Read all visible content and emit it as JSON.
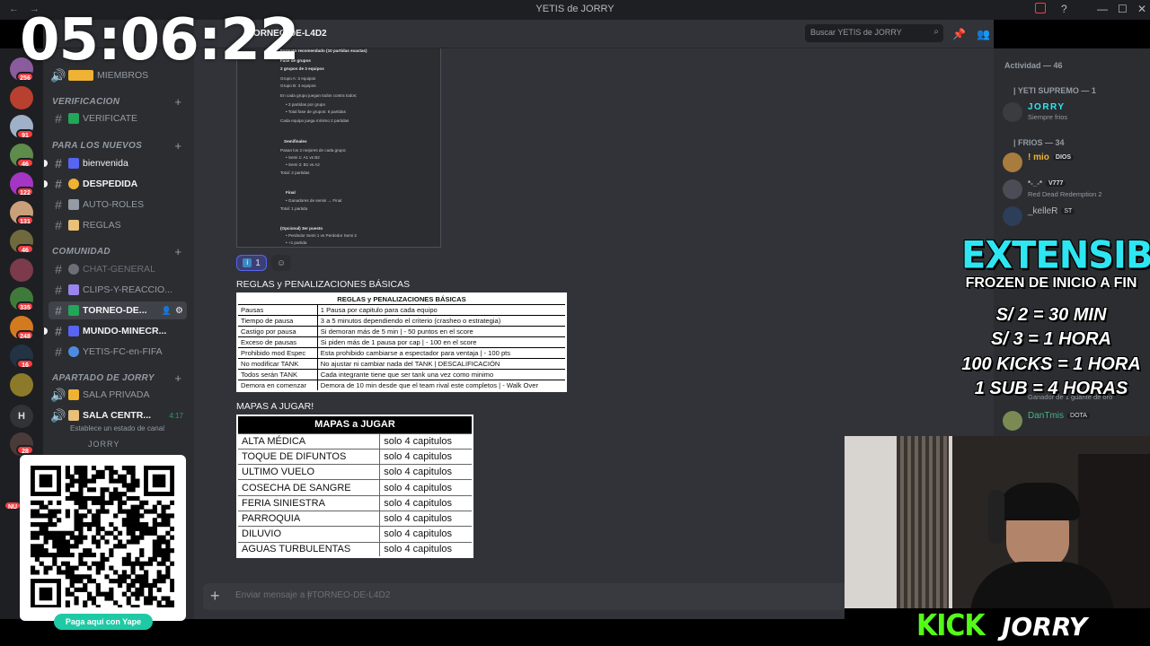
{
  "titlebar": {
    "title": "YETIS de JORRY"
  },
  "overlay": {
    "clock": "05:06:22",
    "extensible": "EXTENSIBLE",
    "frozen": "FROZEN DE INICIO A FIN",
    "prices": [
      "S/ 2 = 30 MIN",
      "S/ 3 = 1 HORA",
      "100 KICKS = 1 HORA",
      "1 SUB = 4 HORAS"
    ],
    "yape_button": "Paga aquí con Yape",
    "kick_logo": "KICK",
    "kick_name": "JORRY"
  },
  "guilds": {
    "badges": [
      "256",
      "91",
      "46",
      "122",
      "131",
      "46",
      "335",
      "248",
      "16",
      "28"
    ],
    "h_label": "H",
    "nu_label": "NU"
  },
  "server": {
    "name": "YETIS de JORRY"
  },
  "sidebar": {
    "top_channel": "MIEMBROS",
    "categories": [
      {
        "name": "VERIFICACION",
        "channels": [
          "VERIFICATE"
        ]
      },
      {
        "name": "PARA LOS NUEVOS",
        "channels": [
          "bienvenida",
          "DESPEDIDA",
          "AUTO-ROLES",
          "REGLAS"
        ]
      },
      {
        "name": "COMUNIDAD",
        "channels": [
          "CHAT-GENERAL",
          "CLIPS-Y-REACCIO...",
          "TORNEO-DE...",
          "MUNDO-MINECR...",
          "YETIS-FC-en-FIFA"
        ]
      },
      {
        "name": "APARTADO DE JORRY",
        "channels": [
          "SALA PRIVADA",
          "SALA CENTR..."
        ]
      }
    ],
    "voice_timer": "4:17",
    "voice_status": "Establece un estado de canal",
    "voice_user": "JORRY"
  },
  "main": {
    "channel_title": "TORNEO-DE-L4D2",
    "search_placeholder": "Buscar YETIS de JORRY",
    "reaction_count": "1",
    "composer_placeholder": "Enviar mensaje a #",
    "composer_channel": "| TORNEO-DE-L4D2"
  },
  "doc": {
    "lines": [
      "Formato recomendado (10 partidas exactas)",
      "Fase de grupos",
      "2 grupos de 3 equipos",
      "Grupo A: 3 equipos",
      "Grupo B: 3 equipos",
      "En cada grupo juegan todos contra todos:",
      "• 3 partidas por grupo",
      "• Total fase de grupos: 6 partidas",
      "Cada equipo juega mínimo 2 partidas",
      "Semifinales",
      "Pasan los 2 mejores de cada grupo:",
      "• Semi 1: A1 vs B2",
      "• Semi 2: B1 vs A2",
      "Total: 2 partidas",
      "Final",
      "• Ganadores de semis → Final",
      "Total: 1 partida",
      "(Opcional) 3er puesto",
      "• Perdedor Semi 1 vs Perdedor Semi 2",
      "• +1 partida"
    ]
  },
  "rules": {
    "section_label": "REGLAS y PENALIZACIONES BÁSICAS",
    "table_title": "REGLAS y PENALIZACIONES BÁSICAS",
    "rows": [
      [
        "Pausas",
        "1 Pausa por capitulo para cada equipo"
      ],
      [
        "Tiempo de pausa",
        "3 a 5 minutos dependiendo el criterio (crasheo o estrategia)"
      ],
      [
        "Castigo por pausa",
        "Si demoran más de 5 min | - 50 puntos en el score"
      ],
      [
        "Exceso de pausas",
        "Si piden más de 1 pausa por cap | - 100 en el score"
      ],
      [
        "Prohibido mod Espec",
        "Esta prohibido cambiarse a espectador para ventaja | - 100 pts"
      ],
      [
        "No modificar TANK",
        "No ajustar ni cambiar nada del TANK | DESCALIFICACIÓN"
      ],
      [
        "Todos serán TANK",
        "Cada integrante tiene que ser tank una vez como minimo"
      ],
      [
        "Demora en comenzar",
        "Demora de 10 min desde que el team rival este completos | - Walk Over"
      ]
    ]
  },
  "maps": {
    "section_label": "MAPAS A JUGAR!",
    "table_title": "MAPAS a JUGAR",
    "rows": [
      [
        "ALTA MÉDICA",
        "solo 4 capitulos"
      ],
      [
        "TOQUE DE DIFUNTOS",
        "solo 4 capitulos"
      ],
      [
        "ULTIMO VUELO",
        "solo 4 capitulos"
      ],
      [
        "COSECHA DE SANGRE",
        "solo 4 capitulos"
      ],
      [
        "FERIA SINIESTRA",
        "solo 4 capitulos"
      ],
      [
        "PARROQUIA",
        "solo 4 capitulos"
      ],
      [
        "DILUVIO",
        "solo 4 capitulos"
      ],
      [
        "AGUAS TURBULENTAS",
        "solo 4 capitulos"
      ]
    ]
  },
  "members": {
    "activity": "Actividad — 46",
    "groups": [
      {
        "name": "| YETI SUPREMO — 1"
      },
      {
        "name": "| FRIOS — 34"
      }
    ],
    "list": [
      {
        "name": "JORRY",
        "status": "Siempre frios",
        "color": "#2ee6f2"
      },
      {
        "name": "! mio",
        "tag": "DIOS",
        "status": "",
        "color": "#f0b232"
      },
      {
        "name": "*-_-*",
        "tag": "V777",
        "status": "Red Dead Redemption 2",
        "color": "#b5bac1"
      },
      {
        "name": "_kelleR",
        "tag": "ST",
        "status": "",
        "color": "#b5bac1"
      },
      {
        "name": "",
        "status": "Ganador de 1 guante de oro",
        "color": "#b5bac1"
      },
      {
        "name": "DanTmis",
        "tag": "DOTA",
        "status": "",
        "color": "#43b581"
      }
    ]
  }
}
